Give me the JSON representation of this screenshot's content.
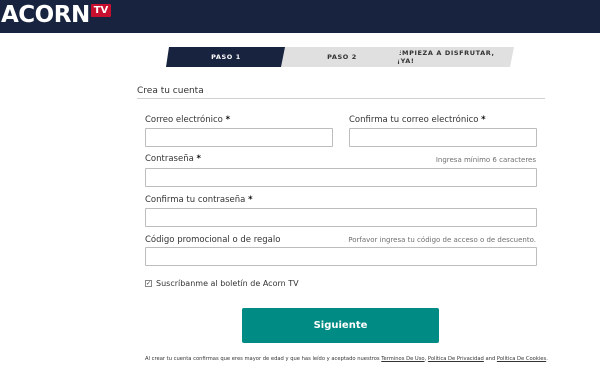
{
  "header": {
    "logo_text": "ACORN",
    "logo_badge": "TV",
    "bg_color": "#18233f",
    "badge_color": "#c8102e"
  },
  "steps": [
    {
      "label": "PASO 1",
      "active": true
    },
    {
      "label": "PASO 2",
      "active": false
    },
    {
      "label": "EMPIEZA A DISFRUTAR, ¡YA!",
      "active": false
    }
  ],
  "form": {
    "title": "Crea tu cuenta",
    "required_mark": "*",
    "email_label": "Correo electrónico",
    "email_value": "",
    "confirm_email_label": "Confirma tu correo electrónico",
    "confirm_email_value": "",
    "password_label": "Contraseña",
    "password_hint": "Ingresa mínimo 6 caracteres",
    "password_value": "",
    "confirm_password_label": "Confirma tu contraseña",
    "confirm_password_value": "",
    "promo_label": "Código promocional o de regalo",
    "promo_hint": "Porfavor ingresa tu código de acceso o de descuento.",
    "promo_value": "",
    "newsletter_label": "Suscríbanme al boletín de Acorn TV",
    "newsletter_checked": true,
    "newsletter_check_glyph": "✓",
    "submit_label": "Siguiente",
    "submit_color": "#008b84"
  },
  "legal": {
    "prefix": "Al crear tu cuenta confirmas que eres mayor de edad y que has leído y aceptado nuestros ",
    "terms_link": "Terminos De Uso",
    "sep1": ", ",
    "privacy_link": "Política De Privacidad",
    "sep2": " and ",
    "cookies_link": "Política De Cookies",
    "suffix": "."
  }
}
